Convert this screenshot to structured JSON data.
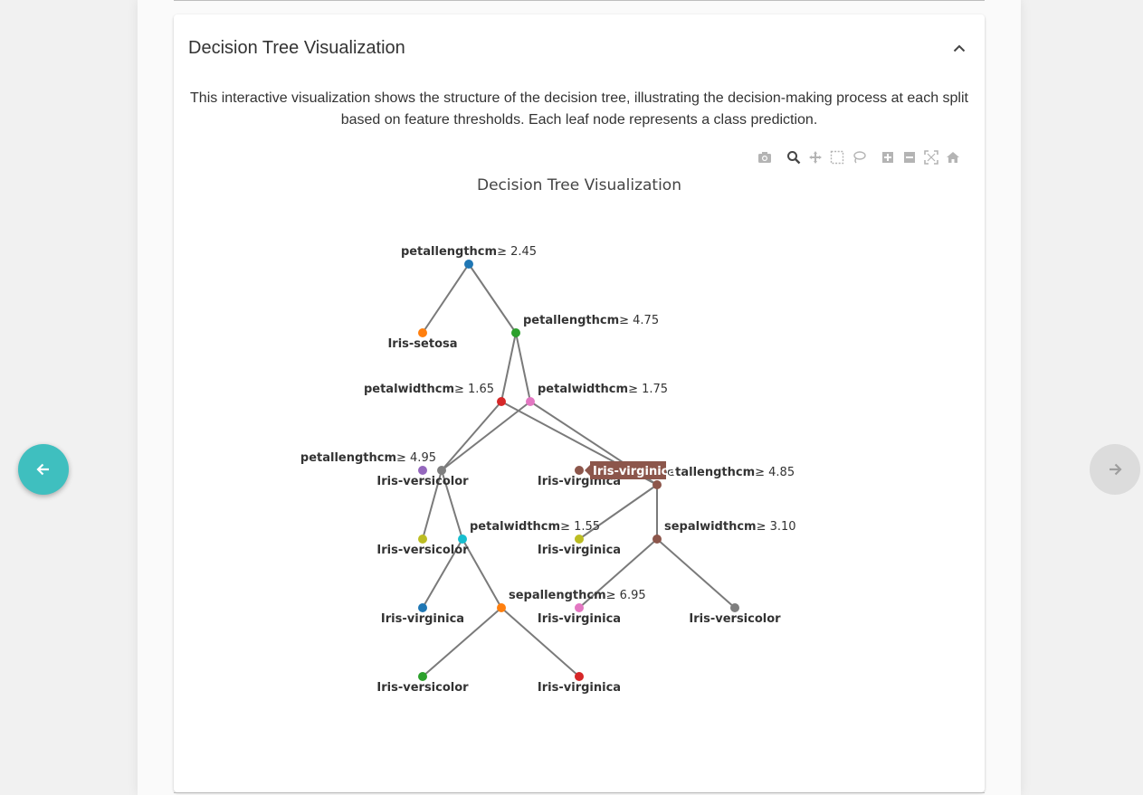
{
  "card": {
    "title": "Decision Tree Visualization",
    "description": "This interactive visualization shows the structure of the decision tree, illustrating the decision-making process at each split based on feature thresholds. Each leaf node represents a class prediction."
  },
  "modebar": {
    "icons": [
      "camera-icon",
      "zoom-icon",
      "pan-icon",
      "box-select-icon",
      "lasso-select-icon",
      "zoom-in-icon",
      "zoom-out-icon",
      "autoscale-icon",
      "reset-axes-icon"
    ]
  },
  "chart_data": {
    "type": "tree",
    "title": "Decision Tree Visualization",
    "nodes": [
      {
        "id": 0,
        "feature": "petallengthcm",
        "op": "≥",
        "threshold": "2.45",
        "color": "#1f77b4"
      },
      {
        "id": 1,
        "leaf": "Iris-setosa",
        "color": "#ff7f0e"
      },
      {
        "id": 2,
        "feature": "petallengthcm",
        "op": "≥",
        "threshold": "4.75",
        "color": "#2ca02c"
      },
      {
        "id": 3,
        "feature": "petalwidthcm",
        "op": "≥",
        "threshold": "1.65",
        "color": "#d62728"
      },
      {
        "id": 4,
        "feature": "petalwidthcm",
        "op": "≥",
        "threshold": "1.75",
        "color": "#e377c2"
      },
      {
        "id": 5,
        "feature": "petallengthcm",
        "op": "≥",
        "threshold": "4.95",
        "color": "#7f7f7f"
      },
      {
        "id": 6,
        "feature": "petallengthcm",
        "op": "≥",
        "threshold": "4.85",
        "color": "#8c564b"
      },
      {
        "id": 7,
        "leaf": "Iris-versicolor",
        "color": "#9467bd"
      },
      {
        "id": 8,
        "leaf": "Iris-virginica",
        "color": "#8c564b"
      },
      {
        "id": 9,
        "leaf": "Iris-versicolor",
        "color": "#bcbd22"
      },
      {
        "id": 10,
        "feature": "petalwidthcm",
        "op": "≥",
        "threshold": "1.55",
        "color": "#17becf"
      },
      {
        "id": 11,
        "leaf": "Iris-virginica",
        "color": "#bcbd22"
      },
      {
        "id": 12,
        "feature": "sepalwidthcm",
        "op": "≥",
        "threshold": "3.10",
        "color": "#8c564b"
      },
      {
        "id": 13,
        "leaf": "Iris-virginica",
        "color": "#1f77b4"
      },
      {
        "id": 14,
        "feature": "sepallengthcm",
        "op": "≥",
        "threshold": "6.95",
        "color": "#ff7f0e"
      },
      {
        "id": 15,
        "leaf": "Iris-virginica",
        "color": "#e377c2"
      },
      {
        "id": 16,
        "leaf": "Iris-versicolor",
        "color": "#7f7f7f"
      },
      {
        "id": 17,
        "leaf": "Iris-versicolor",
        "color": "#2ca02c"
      },
      {
        "id": 18,
        "leaf": "Iris-virginica",
        "color": "#d62728"
      }
    ],
    "edges": [
      [
        0,
        1
      ],
      [
        0,
        2
      ],
      [
        2,
        3
      ],
      [
        2,
        4
      ],
      [
        3,
        5
      ],
      [
        3,
        6
      ],
      [
        4,
        5
      ],
      [
        4,
        6
      ],
      [
        5,
        9
      ],
      [
        5,
        10
      ],
      [
        6,
        11
      ],
      [
        6,
        12
      ],
      [
        10,
        13
      ],
      [
        10,
        14
      ],
      [
        12,
        15
      ],
      [
        12,
        16
      ],
      [
        14,
        17
      ],
      [
        14,
        18
      ]
    ],
    "hover": {
      "node": 8,
      "text": "Iris-virginica",
      "color": "#8c564b"
    }
  }
}
